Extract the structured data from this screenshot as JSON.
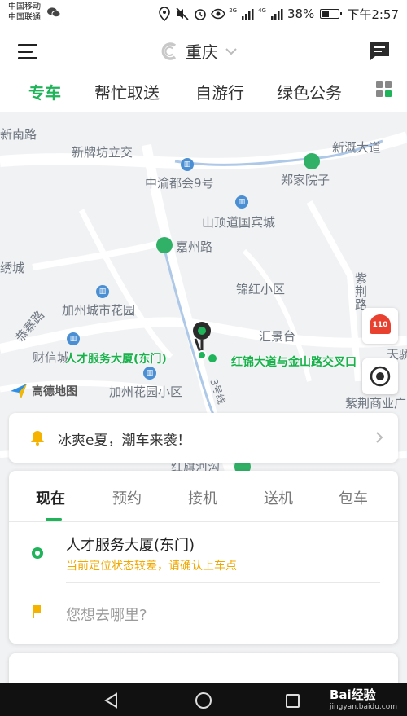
{
  "status_bar": {
    "carrier_1": "中国移动",
    "carrier_2": "中国联通",
    "net_1": "2G",
    "net_2": "4G",
    "battery": "38%",
    "battery_level": 0.38,
    "time": "下午2:57",
    "icons": [
      "wechat-icon",
      "location-icon",
      "mute-icon",
      "alarm-icon",
      "eye-icon",
      "signal-icon",
      "battery-icon"
    ]
  },
  "header": {
    "city": "重庆",
    "icons": [
      "menu-icon",
      "city-logo-icon",
      "chevron-down-icon",
      "chat-icon"
    ]
  },
  "service_tabs": [
    "专车",
    "帮忙取送",
    "自游行",
    "绿色公务"
  ],
  "service_tabs_active": 0,
  "map": {
    "labels": [
      "新南路",
      "新牌坊立交",
      "新溉大道",
      "中渝都会9号",
      "郑家院子",
      "山顶道国宾城",
      "嘉州路",
      "绣城",
      "锦红小区",
      "紫荆路",
      "加州城市花园",
      "恭寨路",
      "汇景台",
      "财信城",
      "天骄",
      "加州花园小区",
      "紫荆商业广",
      "3号线",
      "红旗河沟"
    ],
    "pickup_label": "人才服务大厦(东门)",
    "road_label": "红锦大道与金山路交叉口",
    "amap_brand": "高德地图",
    "sos_label": "110",
    "accent_color": "#1fb35a"
  },
  "promo": {
    "text": "冰爽e夏，潮车来袭！",
    "icons": [
      "bell-icon",
      "chevron-right-icon"
    ]
  },
  "booking": {
    "modes": [
      "现在",
      "预约",
      "接机",
      "送机",
      "包车"
    ],
    "mode_active": 0,
    "start": "人才服务大厦(东门)",
    "start_warning": "当前定位状态较差，请确认上车点",
    "destination_placeholder": "您想去哪里?",
    "warning_color": "#f0a800"
  },
  "watermark": {
    "brand": "Bai经验",
    "url": "jingyan.baidu.com"
  }
}
